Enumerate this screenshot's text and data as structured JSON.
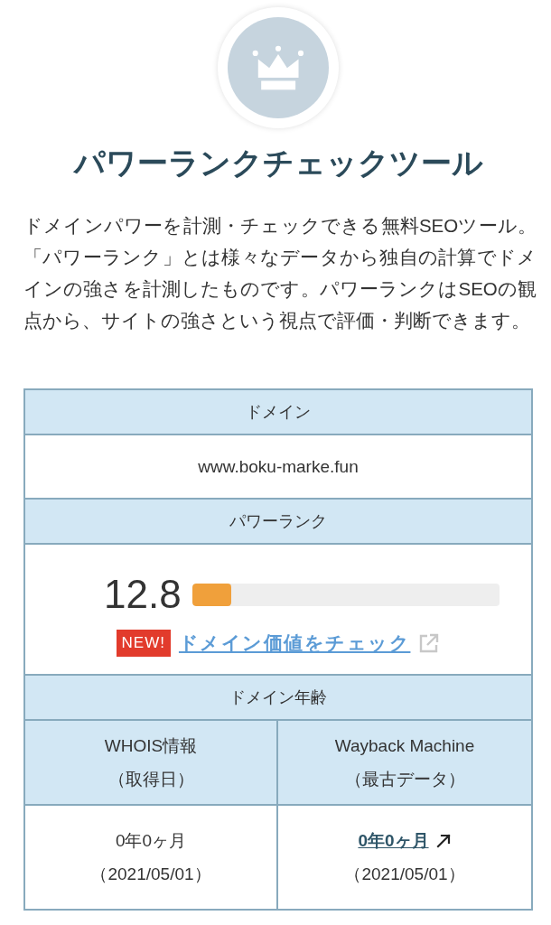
{
  "header": {
    "title": "パワーランクチェックツール",
    "description": "ドメインパワーを計測・チェックできる無料SEOツール。「パワーランク」とは様々なデータから独自の計算でドメインの強さを計測したものです。パワーランクはSEOの観点から、サイトの強さという視点で評価・判断できます。"
  },
  "table": {
    "domain_label": "ドメイン",
    "domain": "www.boku-marke.fun",
    "power_rank_label": "パワーランク",
    "power_rank": {
      "score": "12.8",
      "level": 0.128,
      "badge": "NEW!",
      "link": "ドメイン価値をチェック"
    },
    "age_label": "ドメイン年齢",
    "age_columns": [
      {
        "kind": "plain",
        "title": "WHOIS情報",
        "subtitle": "（取得日）",
        "age": "0年0ヶ月",
        "date": "（2021/05/01）"
      },
      {
        "kind": "link",
        "title": "Wayback Machine",
        "subtitle": "（最古データ）",
        "age": "0年0ヶ月",
        "date": "（2021/05/01）"
      }
    ]
  }
}
